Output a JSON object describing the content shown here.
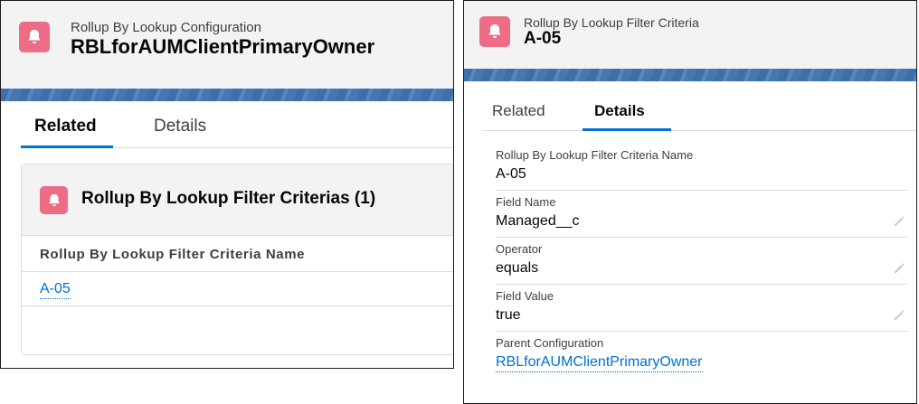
{
  "left": {
    "header": {
      "type_label": "Rollup By Lookup Configuration",
      "title": "RBLforAUMClientPrimaryOwner",
      "icon": "bell-icon"
    },
    "tabs": [
      {
        "label": "Related",
        "active": true
      },
      {
        "label": "Details",
        "active": false
      }
    ],
    "related_card": {
      "title": "Rollup By Lookup Filter Criterias (1)",
      "icon": "bell-icon",
      "column_header": "Rollup By Lookup Filter Criteria Name",
      "rows": [
        "A-05"
      ]
    }
  },
  "right": {
    "header": {
      "type_label": "Rollup By Lookup Filter Criteria",
      "title": "A-05",
      "icon": "bell-icon"
    },
    "tabs": [
      {
        "label": "Related",
        "active": false
      },
      {
        "label": "Details",
        "active": true
      }
    ],
    "fields": [
      {
        "label": "Rollup By Lookup Filter Criteria Name",
        "value": "A-05",
        "editable": false
      },
      {
        "label": "Field Name",
        "value": "Managed__c",
        "editable": true
      },
      {
        "label": "Operator",
        "value": "equals",
        "editable": true
      },
      {
        "label": "Field Value",
        "value": "true",
        "editable": true
      },
      {
        "label": "Parent Configuration",
        "value": "RBLforAUMClientPrimaryOwner",
        "editable": false,
        "link": true
      }
    ]
  },
  "colors": {
    "accent": "#0070d2",
    "icon_bg": "#ed6d87",
    "header_bg": "#f3f3f3",
    "banner": "#3d6fa8"
  }
}
